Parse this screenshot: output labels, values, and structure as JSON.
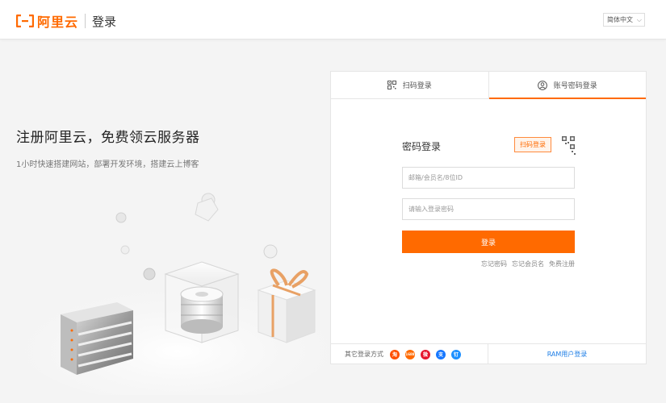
{
  "header": {
    "brand": "阿里云",
    "title": "登录",
    "language": "简体中文",
    "brand_color": "#ff6a00"
  },
  "hero": {
    "title": "注册阿里云，免费领云服务器",
    "subtitle": "1小时快速搭建网站，部署开发环境，搭建云上博客"
  },
  "tabs": [
    {
      "label": "扫码登录",
      "icon": "qr-code-icon",
      "active": false
    },
    {
      "label": "账号密码登录",
      "icon": "user-icon",
      "active": true
    }
  ],
  "form": {
    "title": "密码登录",
    "scan_tip": "扫码登录",
    "account_placeholder": "邮箱/会员名/8位ID",
    "password_placeholder": "请输入登录密码",
    "submit_label": "登录",
    "links": [
      "忘记密码",
      "忘记会员名",
      "免费注册"
    ]
  },
  "footer": {
    "other_login_label": "其它登录方式",
    "social": [
      {
        "name": "taobao-icon",
        "glyph": "淘",
        "color": "#ff5000"
      },
      {
        "name": "alipay-oversea-icon",
        "glyph": "1688",
        "color": "#ff6a00"
      },
      {
        "name": "weibo-icon",
        "glyph": "微",
        "color": "#e6162d"
      },
      {
        "name": "alipay-icon",
        "glyph": "支",
        "color": "#1677ff"
      },
      {
        "name": "dingtalk-icon",
        "glyph": "钉",
        "color": "#1e90ff"
      }
    ],
    "ram_login": "RAM用户登录"
  }
}
